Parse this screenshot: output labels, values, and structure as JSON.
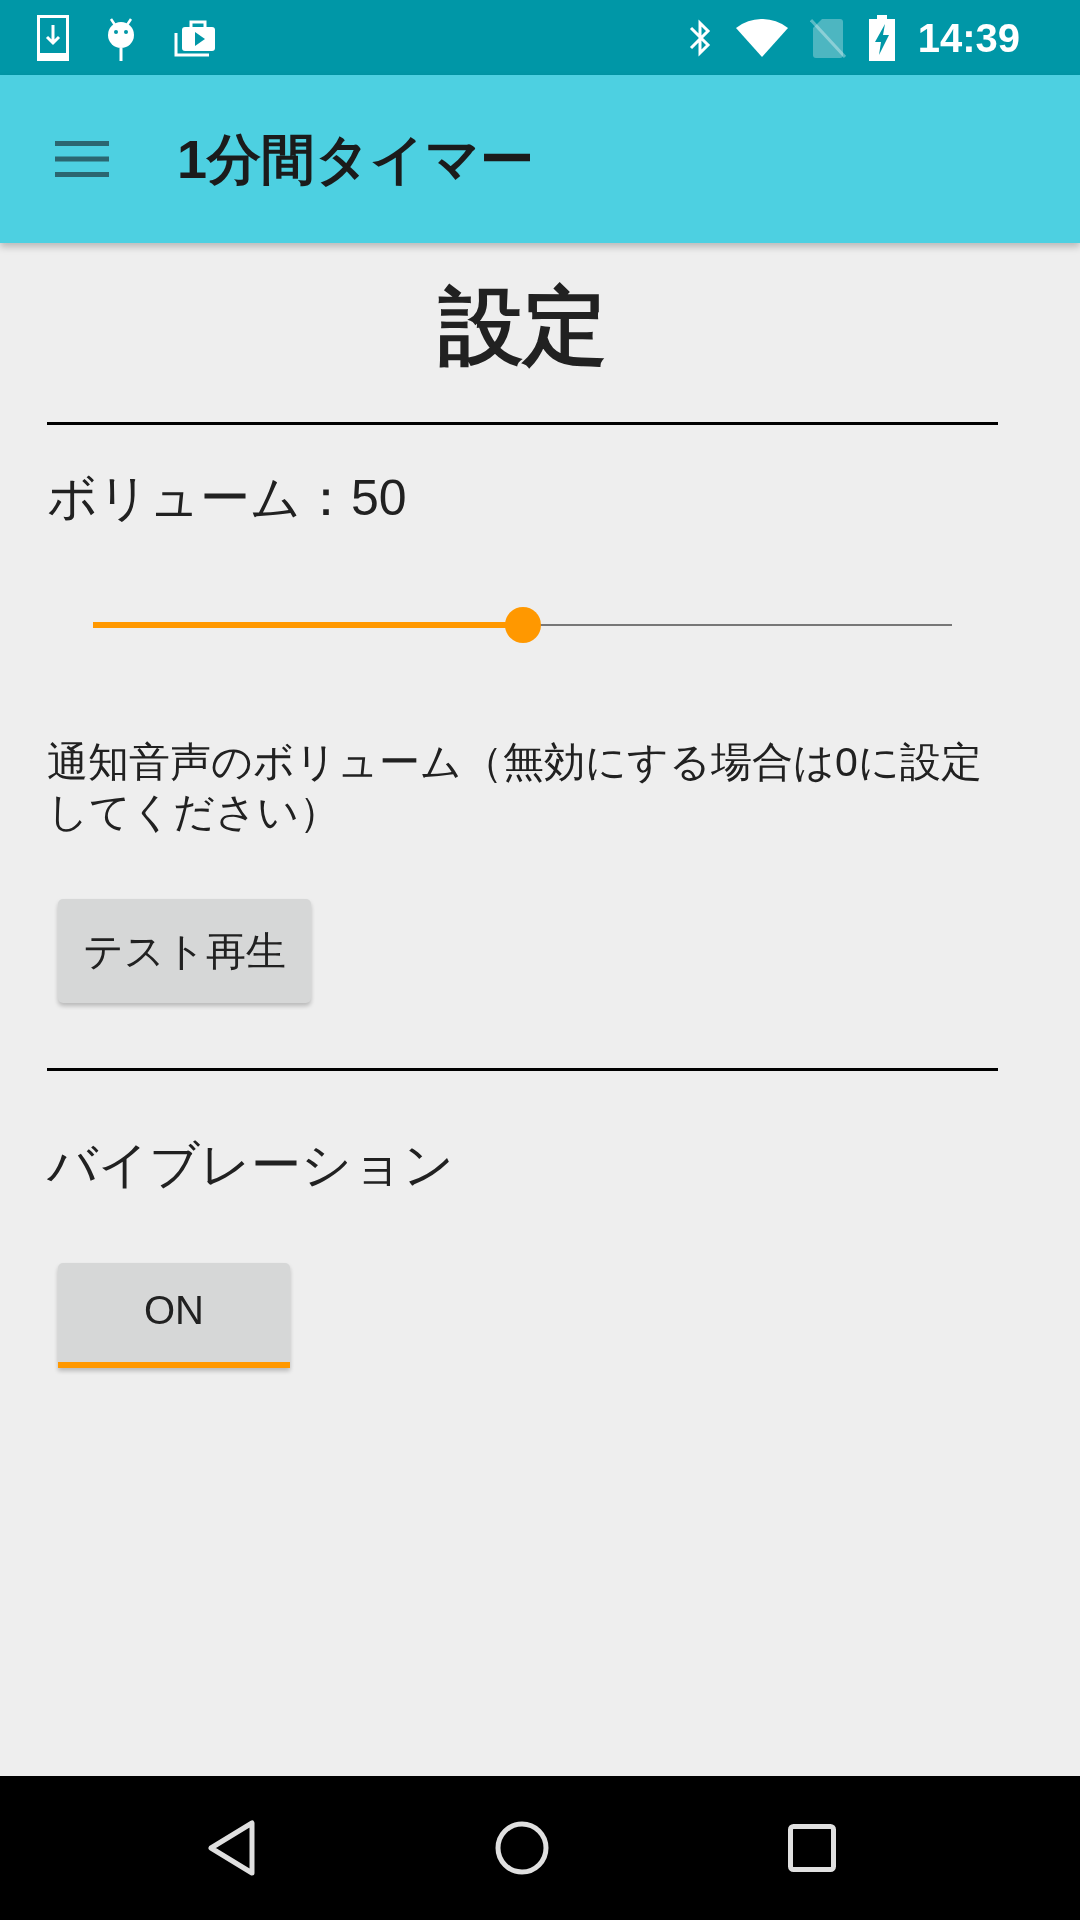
{
  "status_bar": {
    "time": "14:39"
  },
  "toolbar": {
    "title": "1分間タイマー"
  },
  "page": {
    "heading": "設定"
  },
  "volume": {
    "label": "ボリューム：50",
    "slider": {
      "level": 0.5
    },
    "description": "通知音声のボリューム（無効にする場合は0に設定してください）",
    "test_button": "テスト再生"
  },
  "vibration": {
    "label": "バイブレーション",
    "toggle": {
      "label": "ON",
      "checked": true
    }
  }
}
